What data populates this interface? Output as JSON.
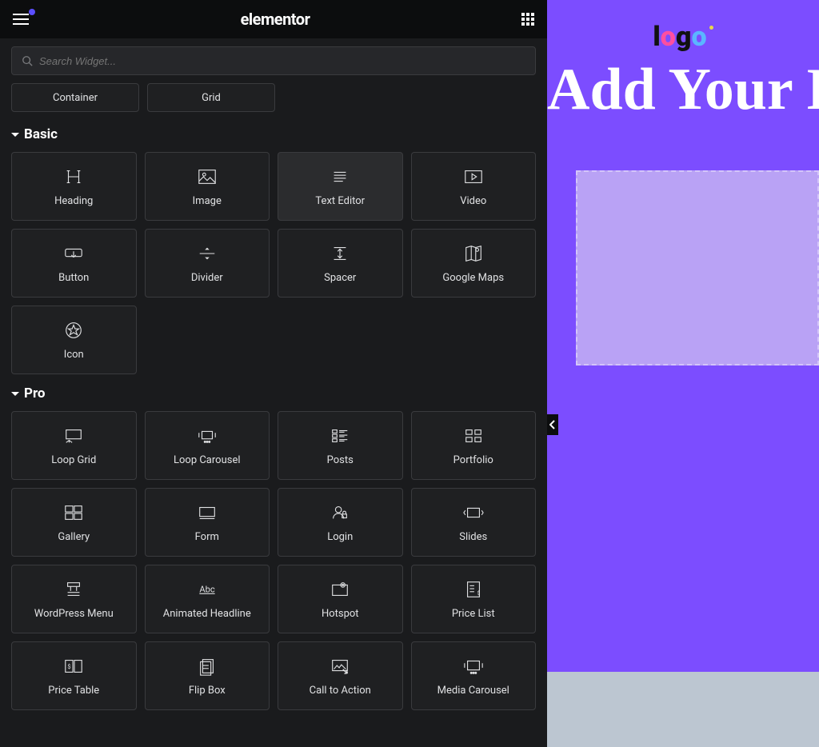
{
  "header": {
    "brand": "elementor"
  },
  "search": {
    "placeholder": "Search Widget..."
  },
  "layout_row": [
    "Container",
    "Grid"
  ],
  "sections": [
    {
      "title": "Basic",
      "widgets": [
        "Heading",
        "Image",
        "Text Editor",
        "Video",
        "Button",
        "Divider",
        "Spacer",
        "Google Maps",
        "Icon"
      ]
    },
    {
      "title": "Pro",
      "widgets": [
        "Loop Grid",
        "Loop Carousel",
        "Posts",
        "Portfolio",
        "Gallery",
        "Form",
        "Login",
        "Slides",
        "WordPress Menu",
        "Animated Headline",
        "Hotspot",
        "Price List",
        "Price Table",
        "Flip Box",
        "Call to Action",
        "Media Carousel"
      ]
    }
  ],
  "hovered_widget": "Text Editor",
  "canvas": {
    "logo_text": "logo",
    "headline": "Add Your He"
  }
}
